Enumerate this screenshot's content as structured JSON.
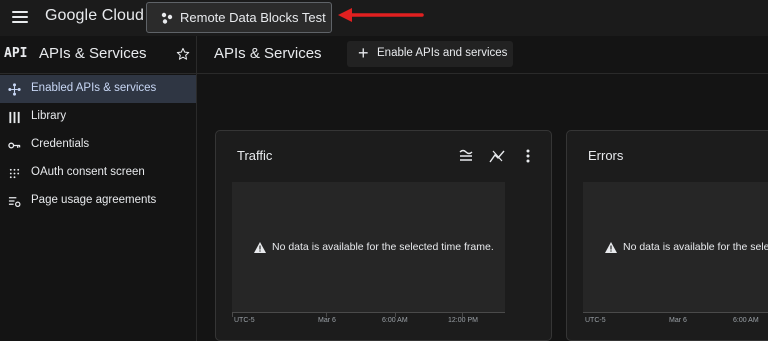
{
  "topbar": {
    "brand": "Google Cloud",
    "project_name": "Remote Data Blocks Test",
    "annotation_arrow_color": "#e02020"
  },
  "subbar": {
    "badge": "API",
    "section_title": "APIs & Services",
    "main_title": "APIs & Services",
    "enable_button": "Enable APIs and services"
  },
  "sidebar": {
    "items": [
      {
        "label": "Enabled APIs & services",
        "icon": "diamond-dots-icon",
        "active": true
      },
      {
        "label": "Library",
        "icon": "library-icon",
        "active": false
      },
      {
        "label": "Credentials",
        "icon": "key-icon",
        "active": false
      },
      {
        "label": "OAuth consent screen",
        "icon": "dotted-grid-icon",
        "active": false
      },
      {
        "label": "Page usage agreements",
        "icon": "list-settings-icon",
        "active": false
      }
    ]
  },
  "cards": [
    {
      "title": "Traffic",
      "empty_message": "No data is available for the selected time frame.",
      "x_ticks": [
        "UTC-5",
        "Mar 6",
        "6:00 AM",
        "12:00 PM"
      ]
    },
    {
      "title": "Errors",
      "empty_message": "No data is available for the selected time frame.",
      "x_ticks": [
        "UTC-5",
        "Mar 6",
        "6:00 AM"
      ]
    }
  ],
  "colors": {
    "background": "#141414",
    "topbar": "#1b1b1b",
    "active_nav": "#2f3643",
    "card": "#1c1c1c",
    "chart": "#262626"
  }
}
